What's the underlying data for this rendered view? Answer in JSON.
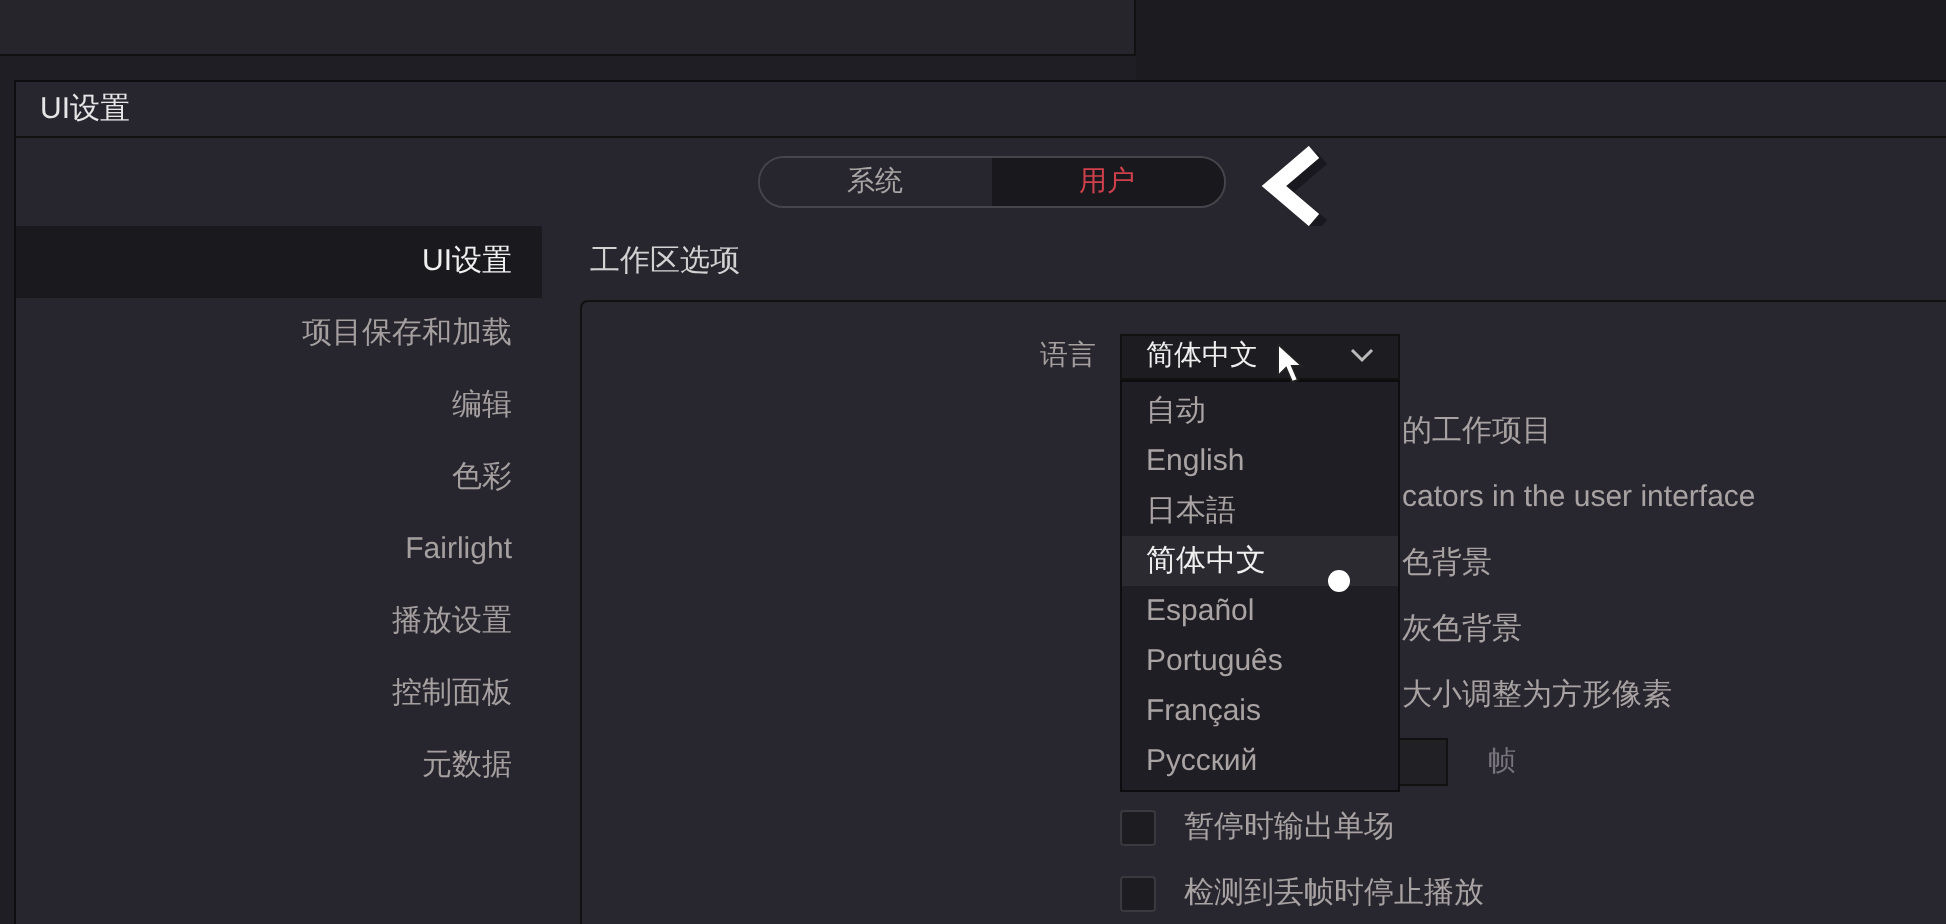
{
  "window": {
    "title": "UI设置"
  },
  "tabs": [
    {
      "label": "系统",
      "selected": false
    },
    {
      "label": "用户",
      "selected": true
    }
  ],
  "sidebar": {
    "items": [
      {
        "label": "UI设置",
        "selected": true
      },
      {
        "label": "项目保存和加载",
        "selected": false
      },
      {
        "label": "编辑",
        "selected": false
      },
      {
        "label": "色彩",
        "selected": false
      },
      {
        "label": "Fairlight",
        "selected": false
      },
      {
        "label": "播放设置",
        "selected": false
      },
      {
        "label": "控制面板",
        "selected": false
      },
      {
        "label": "元数据",
        "selected": false
      }
    ]
  },
  "section": {
    "title": "工作区选项",
    "language": {
      "label": "语言",
      "value": "简体中文",
      "expanded": true,
      "options": [
        {
          "label": "自动",
          "selected": false
        },
        {
          "label": "English",
          "selected": false
        },
        {
          "label": "日本語",
          "selected": false
        },
        {
          "label": "简体中文",
          "selected": true
        },
        {
          "label": "Español",
          "selected": false
        },
        {
          "label": "Português",
          "selected": false
        },
        {
          "label": "Français",
          "selected": false
        },
        {
          "label": "Русский",
          "selected": false
        }
      ]
    },
    "rows": [
      {
        "kind": "text",
        "label": "的工作项目"
      },
      {
        "kind": "text",
        "label": "cators in the user interface"
      },
      {
        "kind": "text",
        "label": "色背景"
      },
      {
        "kind": "text",
        "label": "灰色背景"
      },
      {
        "kind": "text",
        "label": "大小调整为方形像素"
      },
      {
        "kind": "field",
        "unit": "帧"
      },
      {
        "kind": "checkbox",
        "label": "暂停时输出单场",
        "checked": false
      },
      {
        "kind": "checkbox",
        "label": "检测到丢帧时停止播放",
        "checked": false
      }
    ]
  }
}
